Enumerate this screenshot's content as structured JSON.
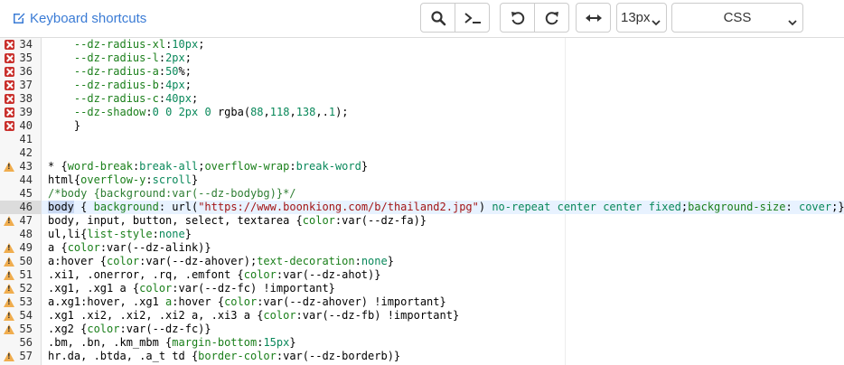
{
  "toolbar": {
    "keyboard_shortcuts": "Keyboard shortcuts",
    "font_size": "13px",
    "language": "CSS",
    "buttons": [
      "search",
      "console",
      "undo",
      "redo",
      "wrap"
    ]
  },
  "colors": {
    "link": "#3a7bd5",
    "property": "#1a7f1a",
    "value": "#09885a",
    "string": "#a31515",
    "error": "#c9302c",
    "warning": "#f0ad4e",
    "active_line": "#e8f2ff"
  },
  "lines": [
    {
      "n": "34",
      "mark": "error",
      "text": "    --dz-radius-xl:10px;"
    },
    {
      "n": "35",
      "mark": "error",
      "text": "    --dz-radius-l:2px;"
    },
    {
      "n": "36",
      "mark": "error",
      "text": "    --dz-radius-a:50%;"
    },
    {
      "n": "37",
      "mark": "error",
      "text": "    --dz-radius-b:4px;"
    },
    {
      "n": "38",
      "mark": "error",
      "text": "    --dz-radius-c:40px;"
    },
    {
      "n": "39",
      "mark": "error",
      "text": "    --dz-shadow:0 0 2px 0 rgba(88,118,138,.1);"
    },
    {
      "n": "40",
      "mark": "error",
      "text": "    }"
    },
    {
      "n": "41",
      "mark": "",
      "text": ""
    },
    {
      "n": "42",
      "mark": "",
      "text": ""
    },
    {
      "n": "43",
      "mark": "warning",
      "text": "* {word-break:break-all;overflow-wrap:break-word}"
    },
    {
      "n": "44",
      "mark": "",
      "text": "html{overflow-y:scroll}"
    },
    {
      "n": "45",
      "mark": "",
      "text": "/*body {background:var(--dz-bodybg)}*/"
    },
    {
      "n": "46",
      "mark": "",
      "text": "body { background: url(\"https://www.boonkiong.com/b/thailand2.jpg\") no-repeat center center fixed;background-size: cover;}"
    },
    {
      "n": "47",
      "mark": "warning",
      "text": "body, input, button, select, textarea {color:var(--dz-fa)}"
    },
    {
      "n": "48",
      "mark": "",
      "text": "ul,li{list-style:none}"
    },
    {
      "n": "49",
      "mark": "warning",
      "text": "a {color:var(--dz-alink)}"
    },
    {
      "n": "50",
      "mark": "warning",
      "text": "a:hover {color:var(--dz-ahover);text-decoration:none}"
    },
    {
      "n": "51",
      "mark": "warning",
      "text": ".xi1, .onerror, .rq, .emfont {color:var(--dz-ahot)}"
    },
    {
      "n": "52",
      "mark": "warning",
      "text": ".xg1, .xg1 a {color:var(--dz-fc) !important}"
    },
    {
      "n": "53",
      "mark": "warning",
      "text": "a.xg1:hover, .xg1 a:hover {color:var(--dz-ahover) !important}"
    },
    {
      "n": "54",
      "mark": "warning",
      "text": ".xg1 .xi2, .xi2, .xi2 a, .xi3 a {color:var(--dz-fb) !important}"
    },
    {
      "n": "55",
      "mark": "warning",
      "text": ".xg2 {color:var(--dz-fc)}"
    },
    {
      "n": "56",
      "mark": "",
      "text": ".bm, .bn, .km_mbm {margin-bottom:15px}"
    },
    {
      "n": "57",
      "mark": "warning",
      "text": "hr.da, .btda, .a_t td {border-color:var(--dz-borderb)}"
    }
  ],
  "active_line": "46"
}
